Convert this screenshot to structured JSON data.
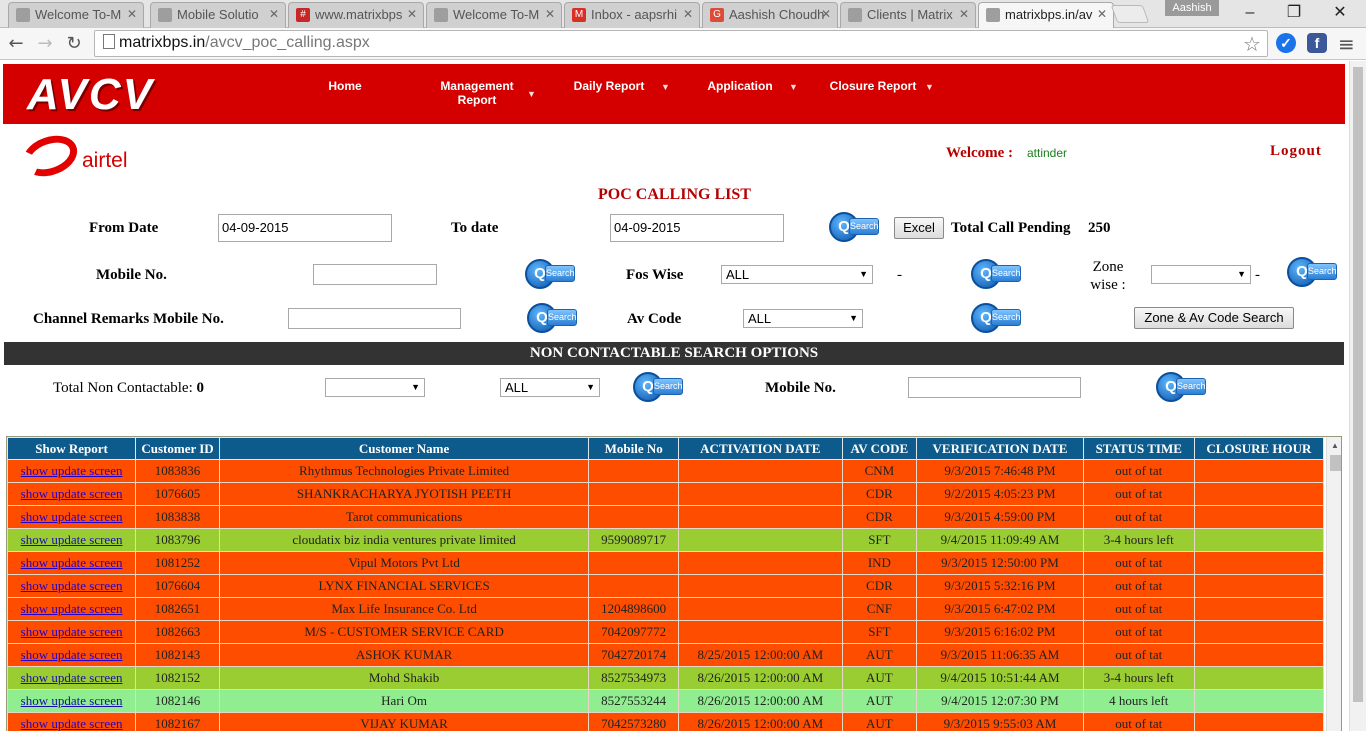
{
  "browser": {
    "tabs": [
      {
        "title": "Welcome To-M",
        "icon": "page-icon"
      },
      {
        "title": "Mobile Solutio",
        "icon": "page-icon"
      },
      {
        "title": "www.matrixbps",
        "icon": "matrix-icon"
      },
      {
        "title": "Welcome To-M",
        "icon": "page-icon"
      },
      {
        "title": "Inbox - aapsrhi",
        "icon": "gmail-icon"
      },
      {
        "title": "Aashish Choudh",
        "icon": "google-plus-icon"
      },
      {
        "title": "Clients | Matrix",
        "icon": "page-icon"
      },
      {
        "title": "matrixbps.in/av",
        "icon": "page-icon"
      }
    ],
    "profile_name": "Aashish",
    "url_host": "matrixbps.in",
    "url_path": "/avcv_poc_calling.aspx"
  },
  "header": {
    "logo": "AVCV",
    "nav": [
      {
        "label": "Home",
        "dropdown": false
      },
      {
        "label": "Management Report",
        "dropdown": true
      },
      {
        "label": "Daily Report",
        "dropdown": true
      },
      {
        "label": "Application",
        "dropdown": true
      },
      {
        "label": "Closure Report",
        "dropdown": true
      }
    ]
  },
  "brand": {
    "airtel": "airtel"
  },
  "user": {
    "welcome_label": "Welcome :",
    "name": "attinder",
    "logout": "Logout"
  },
  "page_title": "POC CALLING LIST",
  "filters": {
    "from_date_label": "From Date",
    "from_date_value": "04-09-2015",
    "to_date_label": "To date",
    "to_date_value": "04-09-2015",
    "excel_label": "Excel",
    "total_call_pending_label": "Total Call Pending",
    "total_call_pending_value": "250",
    "mobile_no_label": "Mobile No.",
    "mobile_no_value": "",
    "fos_wise_label": "Fos Wise",
    "fos_wise_value": "ALL",
    "dash": "-",
    "zone_wise_label_1": "Zone",
    "zone_wise_label_2": "wise :",
    "zone_wise_value": "",
    "channel_remarks_label": "Channel Remarks Mobile No.",
    "channel_remarks_value": "",
    "av_code_label": "Av Code",
    "av_code_value": "ALL",
    "zone_av_button": "Zone & Av Code Search",
    "search_text": "Search"
  },
  "non_contactable": {
    "bar_title": "NON CONTACTABLE SEARCH OPTIONS",
    "total_label": "Total Non Contactable:",
    "total_value": "0",
    "select1_value": "",
    "select2_value": "ALL",
    "mobile_label": "Mobile No.",
    "mobile_value": ""
  },
  "table": {
    "columns": [
      "Show Report",
      "Customer ID",
      "Customer Name",
      "Mobile No",
      "ACTIVATION DATE",
      "AV CODE",
      "VERIFICATION DATE",
      "STATUS TIME",
      "CLOSURE HOUR"
    ],
    "link_label": "show update screen",
    "row_colors": {
      "orange": "#ff4d00",
      "green": "#9acd32",
      "light_green": "#90ee90"
    },
    "rows": [
      {
        "status": "orange",
        "customer_id": "1083836",
        "customer_name": "Rhythmus Technologies Private Limited",
        "mobile_no": "",
        "activation_date": "",
        "av_code": "CNM",
        "verification_date": "9/3/2015 7:46:48 PM",
        "status_time": "out of tat",
        "closure_hour": ""
      },
      {
        "status": "orange",
        "customer_id": "1076605",
        "customer_name": "SHANKRACHARYA JYOTISH PEETH",
        "mobile_no": "",
        "activation_date": "",
        "av_code": "CDR",
        "verification_date": "9/2/2015 4:05:23 PM",
        "status_time": "out of tat",
        "closure_hour": ""
      },
      {
        "status": "orange",
        "customer_id": "1083838",
        "customer_name": "Tarot communications",
        "mobile_no": "",
        "activation_date": "",
        "av_code": "CDR",
        "verification_date": "9/3/2015 4:59:00 PM",
        "status_time": "out of tat",
        "closure_hour": ""
      },
      {
        "status": "green",
        "customer_id": "1083796",
        "customer_name": "cloudatix biz india ventures private limited",
        "mobile_no": "9599089717",
        "activation_date": "",
        "av_code": "SFT",
        "verification_date": "9/4/2015 11:09:49 AM",
        "status_time": "3-4 hours left",
        "closure_hour": ""
      },
      {
        "status": "orange",
        "customer_id": "1081252",
        "customer_name": "Vipul Motors Pvt Ltd",
        "mobile_no": "",
        "activation_date": "",
        "av_code": "IND",
        "verification_date": "9/3/2015 12:50:00 PM",
        "status_time": "out of tat",
        "closure_hour": ""
      },
      {
        "status": "orange",
        "customer_id": "1076604",
        "customer_name": "LYNX FINANCIAL SERVICES",
        "mobile_no": "",
        "activation_date": "",
        "av_code": "CDR",
        "verification_date": "9/3/2015 5:32:16 PM",
        "status_time": "out of tat",
        "closure_hour": ""
      },
      {
        "status": "orange",
        "customer_id": "1082651",
        "customer_name": "Max Life Insurance Co. Ltd",
        "mobile_no": "1204898600",
        "activation_date": "",
        "av_code": "CNF",
        "verification_date": "9/3/2015 6:47:02 PM",
        "status_time": "out of tat",
        "closure_hour": ""
      },
      {
        "status": "orange",
        "customer_id": "1082663",
        "customer_name": "M/S - CUSTOMER SERVICE CARD",
        "mobile_no": "7042097772",
        "activation_date": "",
        "av_code": "SFT",
        "verification_date": "9/3/2015 6:16:02 PM",
        "status_time": "out of tat",
        "closure_hour": ""
      },
      {
        "status": "orange",
        "customer_id": "1082143",
        "customer_name": "ASHOK KUMAR",
        "mobile_no": "7042720174",
        "activation_date": "8/25/2015 12:00:00 AM",
        "av_code": "AUT",
        "verification_date": "9/3/2015 11:06:35 AM",
        "status_time": "out of tat",
        "closure_hour": ""
      },
      {
        "status": "green",
        "customer_id": "1082152",
        "customer_name": "Mohd Shakib",
        "mobile_no": "8527534973",
        "activation_date": "8/26/2015 12:00:00 AM",
        "av_code": "AUT",
        "verification_date": "9/4/2015 10:51:44 AM",
        "status_time": "3-4 hours left",
        "closure_hour": ""
      },
      {
        "status": "lgreen",
        "customer_id": "1082146",
        "customer_name": "Hari Om",
        "mobile_no": "8527553244",
        "activation_date": "8/26/2015 12:00:00 AM",
        "av_code": "AUT",
        "verification_date": "9/4/2015 12:07:30 PM",
        "status_time": "4 hours left",
        "closure_hour": ""
      },
      {
        "status": "orange",
        "customer_id": "1082167",
        "customer_name": "VIJAY KUMAR",
        "mobile_no": "7042573280",
        "activation_date": "8/26/2015 12:00:00 AM",
        "av_code": "AUT",
        "verification_date": "9/3/2015 9:55:03 AM",
        "status_time": "out of tat",
        "closure_hour": ""
      }
    ]
  }
}
